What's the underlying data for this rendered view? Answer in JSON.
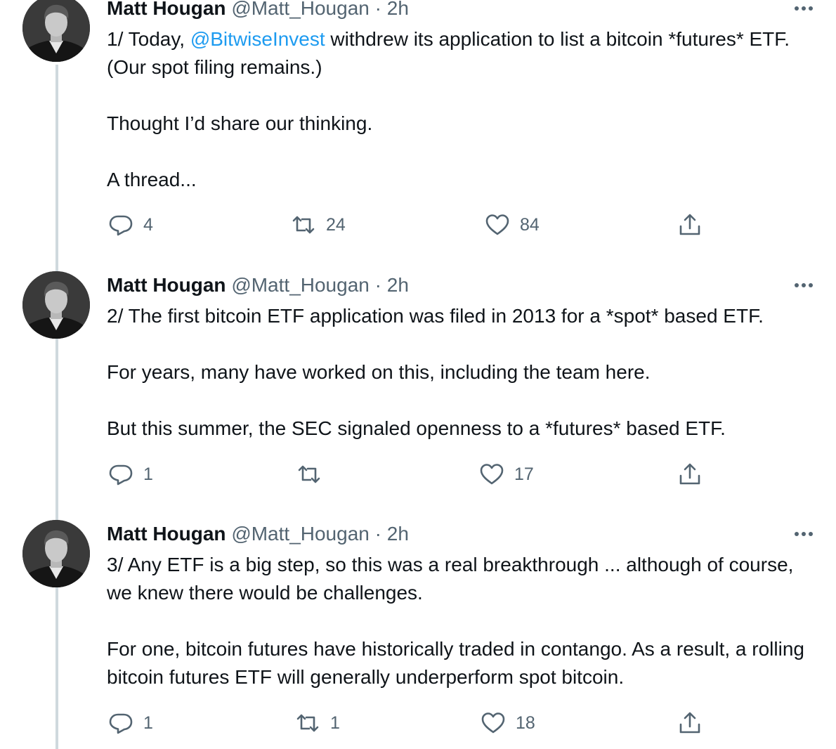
{
  "tweets": [
    {
      "name": "Matt Hougan",
      "handle": "@Matt_Hougan",
      "time": "· 2h",
      "text_prefix": "1/ Today, ",
      "mention": "@BitwiseInvest",
      "text_suffix": " withdrew its application to list a bitcoin *futures* ETF. (Our spot filing remains.)\n\nThought I’d share our thinking.\n\nA thread...",
      "replies": "4",
      "retweets": "24",
      "likes": "84"
    },
    {
      "name": "Matt Hougan",
      "handle": "@Matt_Hougan",
      "time": "· 2h",
      "text": "2/ The first bitcoin ETF application was filed in 2013 for a *spot* based ETF.\n\nFor years, many have worked on this, including the team here.\n\nBut this summer, the SEC signaled openness to a *futures* based ETF.",
      "replies": "1",
      "retweets": "",
      "likes": "17"
    },
    {
      "name": "Matt Hougan",
      "handle": "@Matt_Hougan",
      "time": "· 2h",
      "text": "3/ Any ETF is a big step, so this was a real breakthrough ... although of course, we knew there would be challenges.\n\nFor one, bitcoin futures have historically traded in contango. As a result, a rolling bitcoin futures ETF will generally underperform spot bitcoin.",
      "replies": "1",
      "retweets": "1",
      "likes": "18"
    }
  ],
  "icons": {
    "reply": "reply-icon",
    "retweet": "retweet-icon",
    "like": "heart-icon",
    "share": "share-icon",
    "more": "more-icon",
    "avatar": "avatar"
  },
  "colors": {
    "text": "#0f1419",
    "secondary": "#536471",
    "link": "#1d9bf0",
    "thread_line": "#cfd9de"
  }
}
